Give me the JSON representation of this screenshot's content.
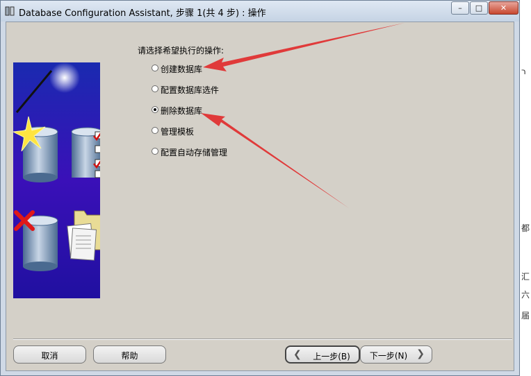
{
  "window": {
    "title": "Database Configuration Assistant, 步骤 1(共 4 步) : 操作",
    "controls": {
      "minimize": "–",
      "maximize": "□",
      "close": "✕"
    }
  },
  "content": {
    "prompt": "请选择希望执行的操作:",
    "options": [
      {
        "label": "创建数据库",
        "selected": false
      },
      {
        "label": "配置数据库选件",
        "selected": false
      },
      {
        "label": "删除数据库",
        "selected": true
      },
      {
        "label": "管理模板",
        "selected": false
      },
      {
        "label": "配置自动存储管理",
        "selected": false
      }
    ]
  },
  "buttons": {
    "cancel": "取消",
    "help": "帮助",
    "back": "上一步(B)",
    "next": "下一步(N)"
  },
  "colors": {
    "dialog_bg": "#d4d0c8",
    "annotation_arrow": "#e03a3a"
  },
  "background_glyphs": [
    "ר",
    "都",
    "汇",
    "六",
    "届"
  ]
}
